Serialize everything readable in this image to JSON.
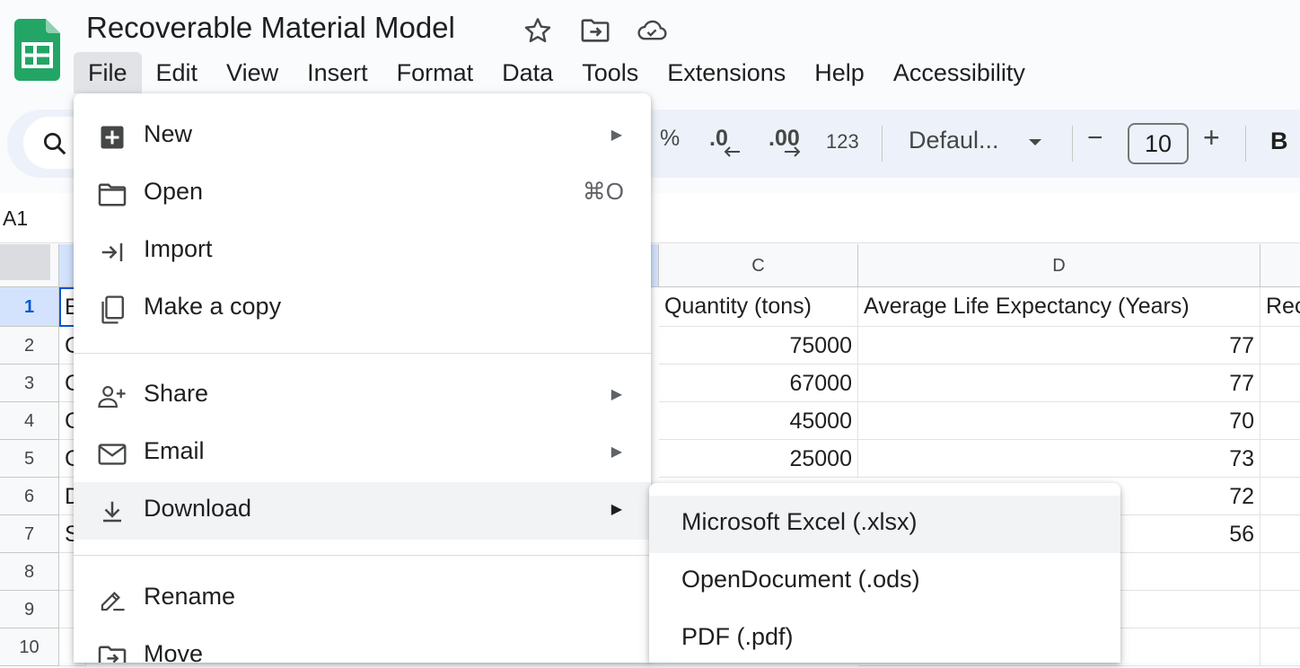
{
  "doc": {
    "title": "Recoverable Material Model"
  },
  "menubar": [
    "File",
    "Edit",
    "View",
    "Insert",
    "Format",
    "Data",
    "Tools",
    "Extensions",
    "Help",
    "Accessibility"
  ],
  "toolbar": {
    "percent": "%",
    "dec_decrease": ".0",
    "dec_increase": ".00",
    "number_format": "123",
    "font": "Defaul...",
    "minus": "−",
    "font_size": "10",
    "plus": "+",
    "bold": "B"
  },
  "name_box": "A1",
  "grid": {
    "columns": [
      "C",
      "D"
    ],
    "rows": [
      "1",
      "2",
      "3",
      "4",
      "5",
      "6",
      "7",
      "8",
      "9",
      "10"
    ],
    "col_a_partial": [
      "E",
      "C",
      "C",
      "C",
      "C",
      "D",
      "S"
    ],
    "header_c": "Quantity (tons)",
    "header_d": "Average Life Expectancy (Years)",
    "header_e_partial": "Rec",
    "col_c": [
      "75000",
      "67000",
      "45000",
      "25000"
    ],
    "col_d": [
      "77",
      "77",
      "70",
      "73",
      "72",
      "56"
    ]
  },
  "file_menu": {
    "new": "New",
    "open": "Open",
    "open_shortcut": "⌘O",
    "import": "Import",
    "make_copy": "Make a copy",
    "share": "Share",
    "email": "Email",
    "download": "Download",
    "rename": "Rename",
    "move": "Move"
  },
  "download_submenu": [
    "Microsoft Excel (.xlsx)",
    "OpenDocument (.ods)",
    "PDF (.pdf)"
  ],
  "colors": {
    "sheets_green": "#0f9d58",
    "toolbar_bg": "#edf2fa",
    "selection_blue": "#0b57d0"
  }
}
